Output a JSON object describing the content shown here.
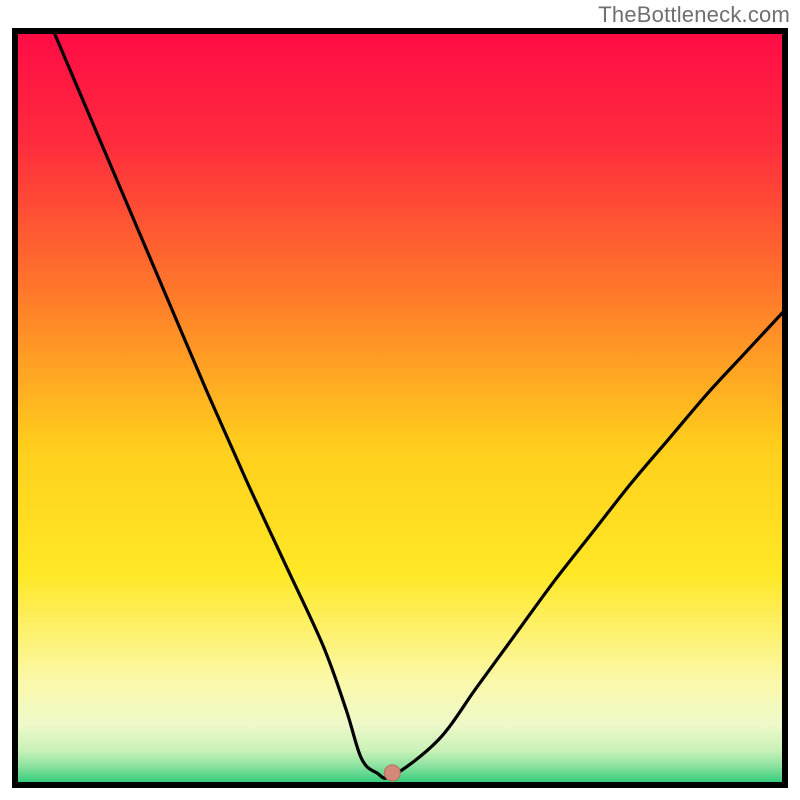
{
  "watermark": "TheBottleneck.com",
  "chart_data": {
    "type": "line",
    "title": "",
    "xlabel": "",
    "ylabel": "",
    "xlim": [
      0,
      100
    ],
    "ylim": [
      0,
      100
    ],
    "grid": false,
    "curve": {
      "name": "bottleneck-curve",
      "x": [
        5,
        10,
        15,
        20,
        25,
        30,
        35,
        40,
        43,
        45,
        47,
        49,
        55,
        60,
        65,
        70,
        75,
        80,
        85,
        90,
        95,
        100
      ],
      "y": [
        100,
        88,
        76,
        64,
        52,
        40.5,
        29.5,
        18.5,
        10,
        3.5,
        1.6,
        1.2,
        6,
        13,
        20,
        27,
        33.5,
        40,
        46,
        52,
        57.5,
        63
      ]
    },
    "minimum_marker": {
      "x": 49,
      "y": 1.6
    },
    "gradient_stops": [
      {
        "pos": 0.0,
        "color": "#ff0b46"
      },
      {
        "pos": 0.15,
        "color": "#ff2c3d"
      },
      {
        "pos": 0.35,
        "color": "#ff7a2a"
      },
      {
        "pos": 0.55,
        "color": "#ffce1c"
      },
      {
        "pos": 0.72,
        "color": "#ffe826"
      },
      {
        "pos": 0.86,
        "color": "#fbf8a8"
      },
      {
        "pos": 0.92,
        "color": "#eef9c9"
      },
      {
        "pos": 0.955,
        "color": "#c8f1b7"
      },
      {
        "pos": 0.975,
        "color": "#8be2a0"
      },
      {
        "pos": 1.0,
        "color": "#27c974"
      }
    ],
    "colors": {
      "curve": "#000000",
      "border": "#000000",
      "marker_fill": "#d48878",
      "marker_stroke": "#b86e5e"
    }
  }
}
